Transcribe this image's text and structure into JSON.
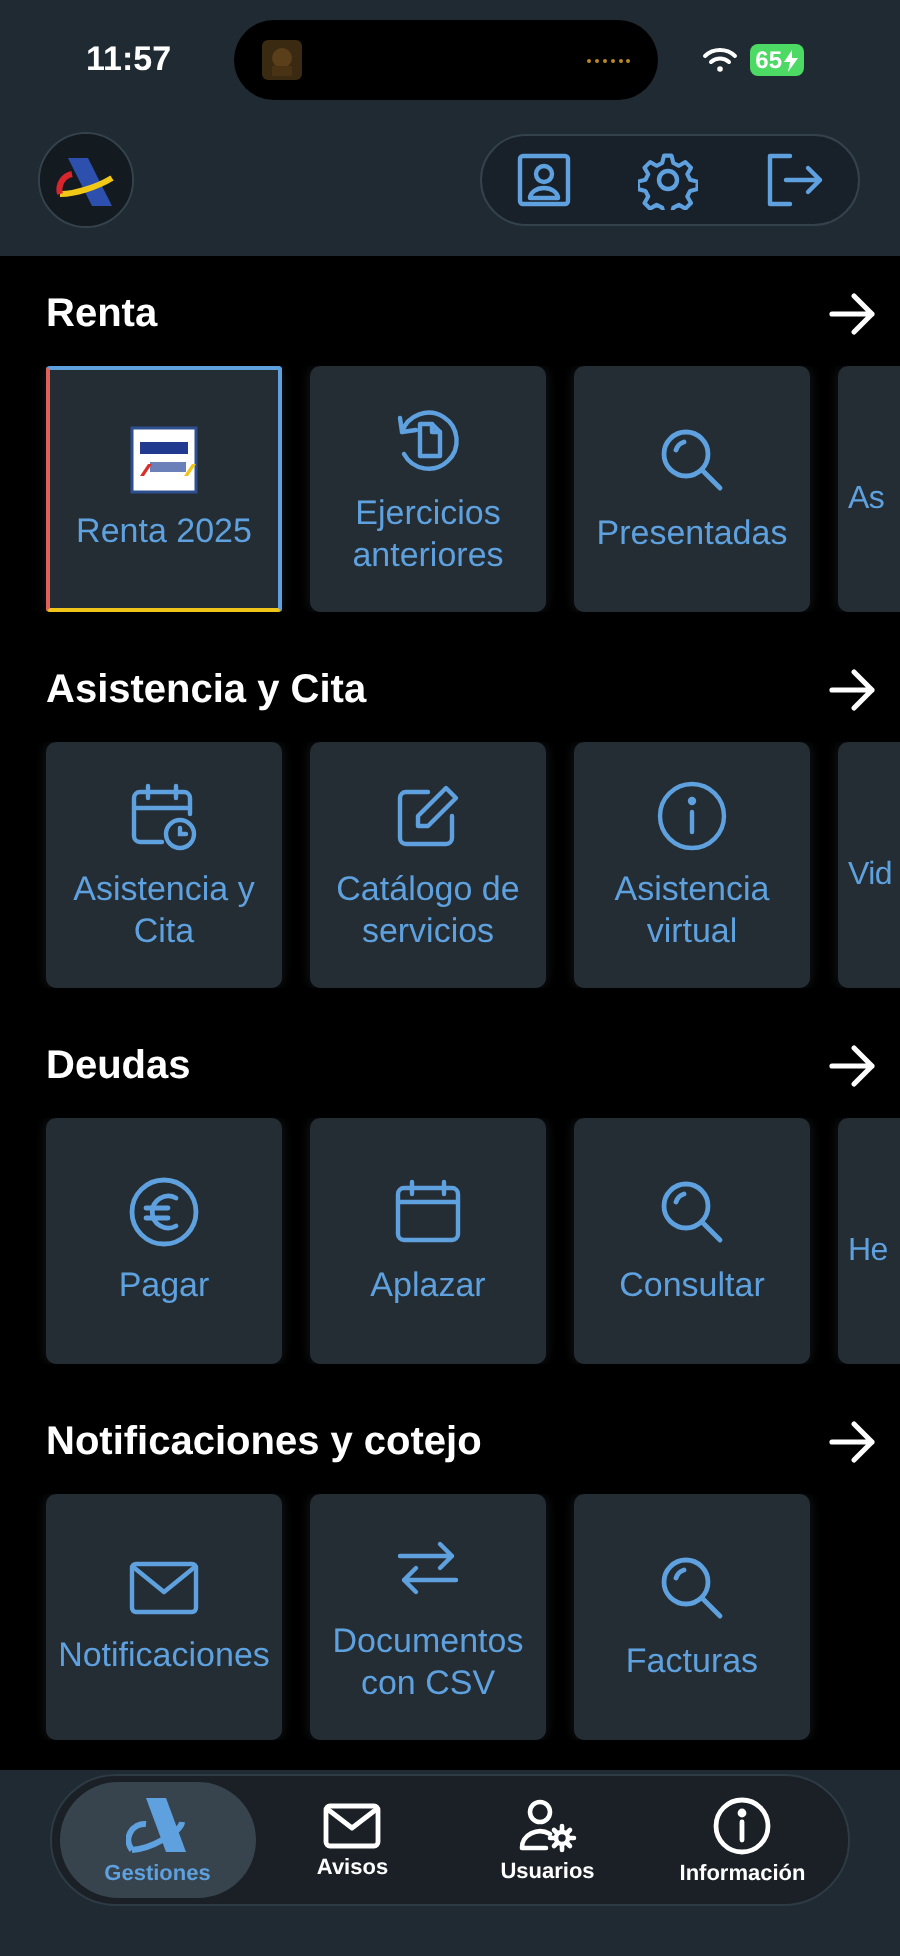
{
  "status_bar": {
    "time": "11:57",
    "battery": "65"
  },
  "sections": [
    {
      "title": "Renta",
      "tiles": [
        {
          "label": "Renta 2025",
          "kind": "full",
          "selected": true
        },
        {
          "label": "Ejercicios anteriores",
          "kind": "full",
          "selected": false
        },
        {
          "label": "Presentadas",
          "kind": "full",
          "selected": false
        },
        {
          "label": "As",
          "kind": "cut",
          "selected": false
        }
      ]
    },
    {
      "title": "Asistencia y Cita",
      "tiles": [
        {
          "label": "Asistencia y Cita",
          "kind": "full",
          "selected": false
        },
        {
          "label": "Catálogo de servicios",
          "kind": "full",
          "selected": false
        },
        {
          "label": "Asistencia virtual",
          "kind": "full",
          "selected": false
        },
        {
          "label": "Vid",
          "kind": "cut",
          "selected": false
        }
      ]
    },
    {
      "title": "Deudas",
      "tiles": [
        {
          "label": "Pagar",
          "kind": "full",
          "selected": false
        },
        {
          "label": "Aplazar",
          "kind": "full",
          "selected": false
        },
        {
          "label": "Consultar",
          "kind": "full",
          "selected": false
        },
        {
          "label": "He",
          "kind": "cut",
          "selected": false
        }
      ]
    },
    {
      "title": "Notificaciones y cotejo",
      "tiles": [
        {
          "label": "Notificaciones",
          "kind": "full",
          "selected": false
        },
        {
          "label": "Documentos con CSV",
          "kind": "full",
          "selected": false
        },
        {
          "label": "Facturas",
          "kind": "full",
          "selected": false
        }
      ]
    }
  ],
  "tabs": [
    {
      "label": "Gestiones",
      "selected": true
    },
    {
      "label": "Avisos",
      "selected": false
    },
    {
      "label": "Usuarios",
      "selected": false
    },
    {
      "label": "Información",
      "selected": false
    }
  ]
}
